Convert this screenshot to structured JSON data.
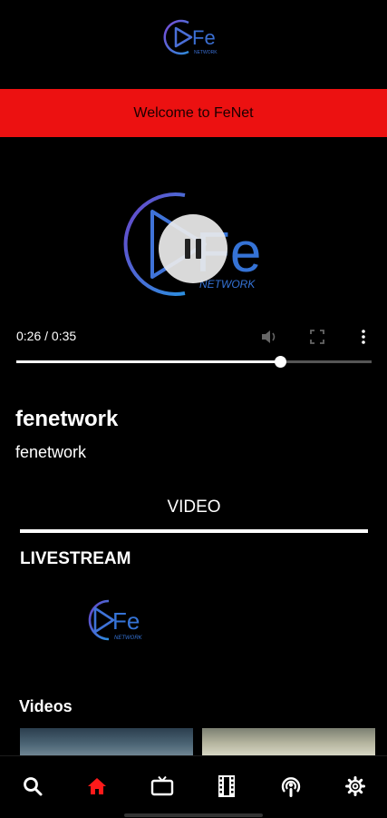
{
  "header": {
    "logo_alt": "Fe Network logo",
    "logo_text": "Fe",
    "logo_subtext": "NETWORK"
  },
  "banner": {
    "text": "Welcome to FeNet",
    "color": "#ec1111"
  },
  "player": {
    "logo_text": "Fe",
    "logo_subtext": "NETWORK",
    "state": "playing",
    "time_display": "0:26 / 0:35",
    "progress_fraction": 0.743,
    "controls": [
      "pause-icon",
      "volume-icon",
      "fullscreen-icon",
      "more-vertical-icon"
    ]
  },
  "channel": {
    "title": "fenetwork",
    "subtitle": "fenetwork"
  },
  "tabs": {
    "active": "VIDEO"
  },
  "livestream": {
    "heading": "LIVESTREAM",
    "logo_text": "Fe",
    "logo_subtext": "NETWORK"
  },
  "videos": {
    "heading": "Videos"
  },
  "bottom_nav": {
    "items": [
      {
        "icon": "search-icon",
        "active": false
      },
      {
        "icon": "home-icon",
        "active": true
      },
      {
        "icon": "tv-icon",
        "active": false
      },
      {
        "icon": "film-icon",
        "active": false
      },
      {
        "icon": "podcast-icon",
        "active": false
      },
      {
        "icon": "settings-icon",
        "active": false
      }
    ],
    "active_color": "#ff1a1a"
  },
  "colors": {
    "accent": "#ec1111",
    "logo_blue": "#3f6fd6",
    "logo_purple": "#6a4bd2"
  }
}
